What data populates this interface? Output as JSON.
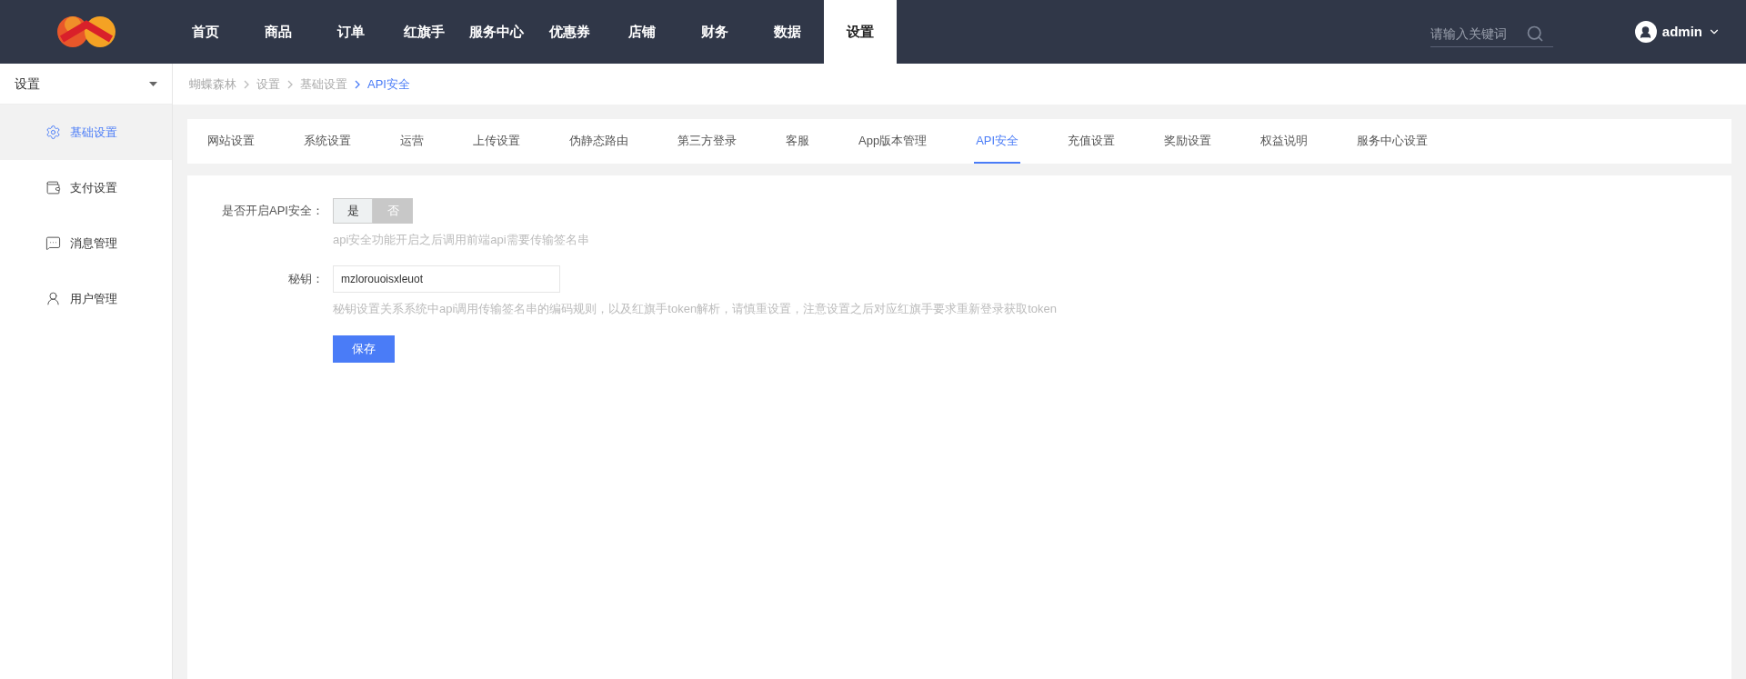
{
  "top_nav": [
    {
      "label": "首页",
      "selected": false
    },
    {
      "label": "商品",
      "selected": false
    },
    {
      "label": "订单",
      "selected": false
    },
    {
      "label": "红旗手",
      "selected": false
    },
    {
      "label": "服务中心",
      "selected": false
    },
    {
      "label": "优惠券",
      "selected": false
    },
    {
      "label": "店铺",
      "selected": false
    },
    {
      "label": "财务",
      "selected": false
    },
    {
      "label": "数据",
      "selected": false
    },
    {
      "label": "设置",
      "selected": true
    }
  ],
  "search": {
    "placeholder": "请输入关键词"
  },
  "user": {
    "name": "admin"
  },
  "sidebar": {
    "title": "设置",
    "items": [
      {
        "label": "基础设置",
        "selected": true
      },
      {
        "label": "支付设置",
        "selected": false
      },
      {
        "label": "消息管理",
        "selected": false
      },
      {
        "label": "用户管理",
        "selected": false
      }
    ]
  },
  "breadcrumb": [
    {
      "label": "蝴蝶森林",
      "current": false
    },
    {
      "label": "设置",
      "current": false
    },
    {
      "label": "基础设置",
      "current": false
    },
    {
      "label": "API安全",
      "current": true
    }
  ],
  "tabs": [
    {
      "label": "网站设置",
      "selected": false
    },
    {
      "label": "系统设置",
      "selected": false
    },
    {
      "label": "运营",
      "selected": false
    },
    {
      "label": "上传设置",
      "selected": false
    },
    {
      "label": "伪静态路由",
      "selected": false
    },
    {
      "label": "第三方登录",
      "selected": false
    },
    {
      "label": "客服",
      "selected": false
    },
    {
      "label": "App版本管理",
      "selected": false
    },
    {
      "label": "API安全",
      "selected": true
    },
    {
      "label": "充值设置",
      "selected": false
    },
    {
      "label": "奖励设置",
      "selected": false
    },
    {
      "label": "权益说明",
      "selected": false
    },
    {
      "label": "服务中心设置",
      "selected": false
    }
  ],
  "form": {
    "api_security": {
      "label": "是否开启API安全：",
      "options": [
        {
          "label": "是",
          "selected": false
        },
        {
          "label": "否",
          "selected": true
        }
      ],
      "hint": "api安全功能开启之后调用前端api需要传输签名串"
    },
    "secret": {
      "label": "秘钥：",
      "value": "mzlorouoisxleuot",
      "hint": "秘钥设置关系系统中api调用传输签名串的编码规则，以及红旗手token解析，请慎重设置，注意设置之后对应红旗手要求重新登录获取token"
    },
    "save_button": "保存"
  }
}
